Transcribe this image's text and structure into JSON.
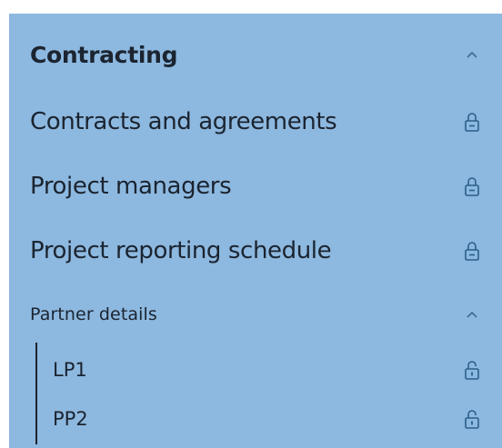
{
  "section": {
    "title": "Contracting",
    "expand_icon": "chevron-up-icon",
    "items": [
      {
        "label": "Contracts and agreements",
        "icon": "lock-icon"
      },
      {
        "label": "Project managers",
        "icon": "lock-icon"
      },
      {
        "label": "Project reporting schedule",
        "icon": "lock-icon"
      }
    ],
    "subsection": {
      "title": "Partner details",
      "expand_icon": "chevron-up-icon",
      "items": [
        {
          "label": "LP1",
          "icon": "lock-open-icon"
        },
        {
          "label": "PP2",
          "icon": "lock-open-icon"
        }
      ]
    }
  },
  "colors": {
    "panel_background": "#8db8df",
    "text": "#1b2430",
    "icon": "#2a5f8c"
  }
}
